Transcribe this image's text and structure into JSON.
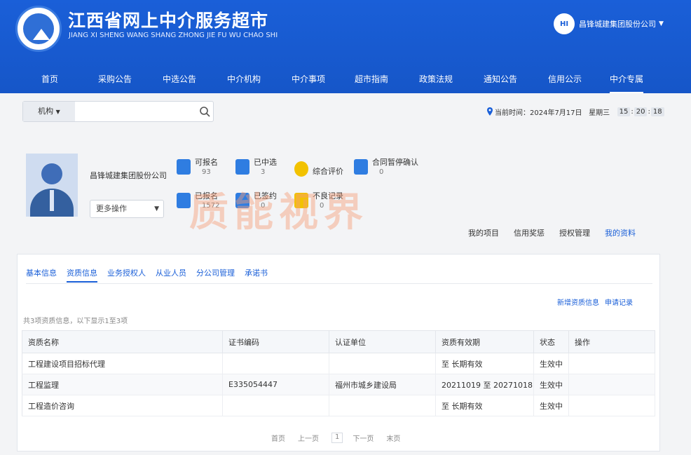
{
  "header": {
    "title": "江西省网上中介服务超市",
    "subtitle": "JIANG XI SHENG WANG SHANG ZHONG JIE FU WU CHAO SHI",
    "user": {
      "avatar_text": "HI",
      "name": "昌锋城建集团股份公司"
    },
    "brand_color": "#1a5fd8"
  },
  "nav": [
    "首页",
    "采购公告",
    "中选公告",
    "中介机构",
    "中介事项",
    "超市指南",
    "政策法规",
    "通知公告",
    "信用公示",
    "中介专属"
  ],
  "nav_active": "中介专属",
  "search": {
    "type_label": "机构",
    "placeholder": ""
  },
  "time": {
    "label": "当前时间：",
    "date": "2024年7月17日",
    "weekday": "星期三",
    "hh": "15",
    "mm": "20",
    "ss": "18"
  },
  "profile": {
    "company": "昌锋城建集团股份公司",
    "more_label": "更多操作",
    "stats": [
      {
        "label": "可报名",
        "value": "93",
        "icon": "list-icon",
        "color": "#2f7de1"
      },
      {
        "label": "已中选",
        "value": "3",
        "icon": "check-icon",
        "color": "#2f7de1"
      },
      {
        "label": "综合评价",
        "value": "",
        "icon": "star-icon",
        "color": "#f2c200"
      },
      {
        "label": "合同暂停确认",
        "value": "0",
        "icon": "contract-icon",
        "color": "#2f7de1"
      },
      {
        "label": "已报名",
        "value": "1572",
        "icon": "signup-icon",
        "color": "#2f7de1"
      },
      {
        "label": "已签约",
        "value": "0",
        "icon": "sign-icon",
        "color": "#2f7de1"
      },
      {
        "label": "不良记录",
        "value": "0",
        "icon": "record-icon",
        "color": "#f2c200"
      }
    ],
    "links": [
      "我的项目",
      "信用奖惩",
      "授权管理",
      "我的资料"
    ],
    "active_link": "我的资料"
  },
  "watermark": "质能视界",
  "tabs": [
    "基本信息",
    "资质信息",
    "业务授权人",
    "从业人员",
    "分公司管理",
    "承诺书"
  ],
  "active_tab": "资质信息",
  "actions": [
    "新增资质信息",
    "申请记录"
  ],
  "count_text": "共3项资质信息，以下显示1至3项",
  "table": {
    "headers": [
      "资质名称",
      "证书编码",
      "认证单位",
      "资质有效期",
      "状态",
      "操作"
    ],
    "rows": [
      [
        "工程建设项目招标代理",
        "",
        "",
        "至 长期有效",
        "生效中",
        ""
      ],
      [
        "工程监理",
        "E335054447",
        "福州市城乡建设局",
        "20211019 至 20271018",
        "生效中",
        ""
      ],
      [
        "工程造价咨询",
        "",
        "",
        "至 长期有效",
        "生效中",
        ""
      ]
    ]
  },
  "pager": {
    "first": "首页",
    "prev": "上一页",
    "current": "1",
    "next": "下一页",
    "last": "末页"
  }
}
